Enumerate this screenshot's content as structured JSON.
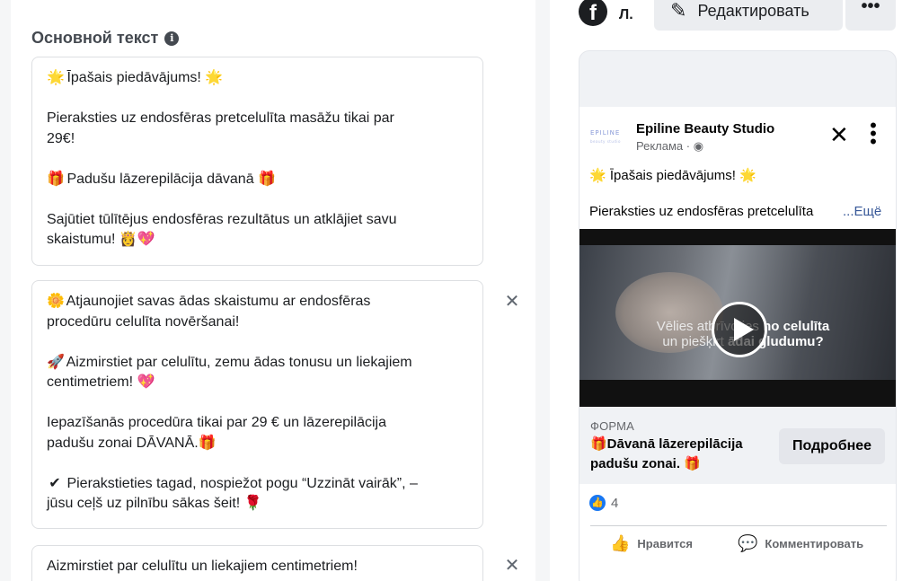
{
  "editor": {
    "section_title": "Основной текст",
    "info_icon": "info-icon",
    "text_variants": [
      {
        "lines": [
          {
            "emoji": "🌟",
            "text": "Īpašais piedāvājums! ",
            "emoji_end": "🌟"
          },
          {
            "text": ""
          },
          {
            "text": "Pieraksties uz endosfēras pretcelulīta masāžu tikai par"
          },
          {
            "text": "29€!"
          },
          {
            "text": ""
          },
          {
            "emoji": "🎁",
            "text": "Padušu lāzerepilācija dāvanā ",
            "emoji_end": "🎁"
          },
          {
            "text": ""
          },
          {
            "text": "Sajūtiet tūlītējus endosfēras rezultātus un atklājiet savu"
          },
          {
            "text": "skaistumu! ",
            "emoji_end": "👸💖"
          }
        ]
      },
      {
        "lines": [
          {
            "emoji": "🌼",
            "text": "Atjaunojiet savas ādas skaistumu ar endosfēras"
          },
          {
            "text": "procedūru celulīta novēršanai!"
          },
          {
            "text": ""
          },
          {
            "emoji": "🚀",
            "text": "Aizmirstiet par celulītu, zemu ādas tonusu un liekajiem"
          },
          {
            "text": "centimetriem! ",
            "emoji_end": "💖"
          },
          {
            "text": ""
          },
          {
            "text": "Iepazīšanās procedūra tikai par 29 € un lāzerepilācija"
          },
          {
            "text": "padušu zonai DĀVANĀ.",
            "emoji_end": "🎁"
          },
          {
            "text": ""
          },
          {
            "emoji": "✔",
            "text": "Pierakstieties tagad, nospiežot pogu “Uzzināt vairāk”, –"
          },
          {
            "text": "jūsu ceļš uz pilnību sākas šeit! ",
            "emoji_end": "🌹"
          }
        ]
      },
      {
        "lines": [
          {
            "text": "Aizmirstiet par celulītu un liekajiem centimetriem!"
          }
        ]
      }
    ],
    "remove_icon": "close-icon"
  },
  "toolbar": {
    "page_initial": "Л.",
    "edit_label": "Редактировать",
    "edit_icon": "pencil-icon",
    "more_icon": "more-icon"
  },
  "ad_preview": {
    "logo_text": "EPILINE",
    "logo_sub": "beauty studio",
    "advertiser": "Epiline Beauty Studio",
    "sponsored": "Реклама · ",
    "primary_line1": "🌟 Īpašais piedāvājums! 🌟",
    "primary_line2": "Pieraksties uz endosfēras pretcelulīta",
    "see_more": "...Ещё",
    "video_text_a": "Vēlies atbrīvoties ",
    "video_text_b": "no celulīta",
    "video_text_c": "un piešķirt ",
    "video_text_d": "ādai gludumu?",
    "form_label": "ФОРМА",
    "headline_line1": "🎁Dāvanā lāzerepilācija",
    "headline_line2": "padušu zonai. 🎁",
    "cta_label": "Подробнее",
    "reaction_count": "4",
    "like_label": "Нравится",
    "comment_label": "Комментировать"
  }
}
